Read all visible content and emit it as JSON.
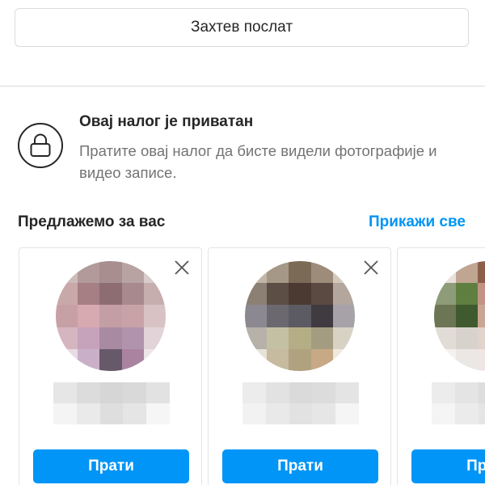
{
  "request_button": {
    "label": "Захтев послат"
  },
  "private_account": {
    "title": "Овај налог је приватан",
    "description": "Пратите овај налог да бисте видели фотографије и видео записе.",
    "icon": "lock-icon"
  },
  "suggestions": {
    "title": "Предлажемо за вас",
    "see_all": "Прикажи све",
    "cards": [
      {
        "follow_label": "Прати",
        "avatar_pixels": [
          "#cdbbb9",
          "#b29a9a",
          "#a88e8e",
          "#b7a3a2",
          "#d9cbca",
          "#c9a8aa",
          "#a57f83",
          "#8e6d72",
          "#a8898c",
          "#c6adae",
          "#c7a0a6",
          "#d7a9b0",
          "#c49ea5",
          "#c9a2a8",
          "#d8c2c4",
          "#d5b6c0",
          "#c7a3bb",
          "#a88ba2",
          "#b293ad",
          "#e2d3d8",
          "#e8dce5",
          "#c9b0c8",
          "#67596a",
          "#a983a0",
          "#ede4ea"
        ],
        "name_pixels": [
          "#e6e6e6",
          "#dcdcdc",
          "#d6d6d6",
          "#d9d9d9",
          "#e2e2e2",
          "#f4f4f4",
          "#eaeaea",
          "#dedede",
          "#e5e5e5",
          "#f6f6f6"
        ]
      },
      {
        "follow_label": "Прати",
        "avatar_pixels": [
          "#c4b6a6",
          "#a69886",
          "#7a6a56",
          "#9c8c79",
          "#d4c8bb",
          "#8c7f74",
          "#5d4e45",
          "#4a3a32",
          "#5a4a41",
          "#b2a69d",
          "#8b8891",
          "#6b6870",
          "#5c5a62",
          "#3f3b41",
          "#a6a2a8",
          "#b6b1a9",
          "#c4c0a3",
          "#b5ad86",
          "#a49c81",
          "#d7d2c4",
          "#e8e3d7",
          "#c6ba9f",
          "#b0a27f",
          "#c7a985",
          "#efe9e0"
        ],
        "name_pixels": [
          "#ececec",
          "#e2e2e2",
          "#dadada",
          "#dcdcdc",
          "#e4e4e4",
          "#f2f2f2",
          "#e9e9e9",
          "#e2e2e2",
          "#e6e6e6",
          "#f5f5f5"
        ]
      },
      {
        "follow_label": "Прати",
        "avatar_pixels": [
          "#e9e0d9",
          "#bfa592",
          "#8c5e4a",
          "#b08a76",
          "#d6c3b8",
          "#8e9c79",
          "#5f7f40",
          "#c29384",
          "#d2a899",
          "#dcc1b6",
          "#6c7654",
          "#3f5a2e",
          "#c9a596",
          "#cfa797",
          "#e3cdc3",
          "#e2dcd7",
          "#d8d2cd",
          "#e1d4cd",
          "#e6dad4",
          "#efe6e2",
          "#f4f1ef",
          "#ebe7e4",
          "#eee6e2",
          "#f0e9e5",
          "#f7f3f1"
        ],
        "name_pixels": [
          "#ececec",
          "#e4e4e4",
          "#dddddd",
          "#e0e0e0",
          "#e8e8e8",
          "#f5f5f5",
          "#ebebeb",
          "#e5e5e5",
          "#e9e9e9",
          "#f7f7f7"
        ]
      }
    ]
  }
}
